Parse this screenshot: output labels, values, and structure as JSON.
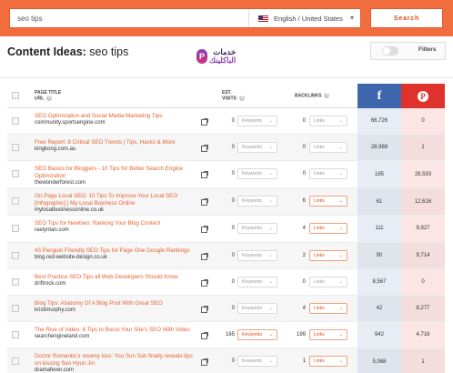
{
  "search": {
    "query": "seo tips",
    "language": "English / United States",
    "button_label": "Search"
  },
  "header": {
    "title_prefix": "Content Ideas:",
    "title_query": "seo tips",
    "filters_label": "Filters",
    "logo_line1": "خدمات",
    "logo_line2": "الباكلينك"
  },
  "columns": {
    "page_title": "PAGE TITLE",
    "url": "URL",
    "est": "EST.",
    "visits": "VISITS",
    "backlinks": "BACKLINKS",
    "facebook": "f",
    "pinterest": "P"
  },
  "dropdown_labels": {
    "keywords": "Keywords",
    "links": "Links"
  },
  "rows": [
    {
      "title": "SEO Optimization and Social Media Marketing Tips",
      "url": "community.sportsengine.com",
      "visits": "0",
      "backlinks": "0",
      "facebook": "66,726",
      "pinterest": "0",
      "kw_active": false,
      "ln_active": false
    },
    {
      "title": "Free Report: 8 Critical SEO Trends | Tips, Hacks & More",
      "url": "kingkong.com.au",
      "visits": "0",
      "backlinks": "0",
      "facebook": "28,988",
      "pinterest": "1",
      "kw_active": false,
      "ln_active": false
    },
    {
      "title": "SEO Basics for Bloggers - 10 Tips for Better Search Engine Optimization",
      "url": "thewonderforest.com",
      "visits": "0",
      "backlinks": "0",
      "facebook": "185",
      "pinterest": "28,593",
      "kw_active": false,
      "ln_active": false
    },
    {
      "title": "On-Page Local SEO: 10 Tips To Improve Your Local SEO [Infographic] | My Local Business Online",
      "url": "mylocalbusinessonline.co.uk",
      "visits": "0",
      "backlinks": "6",
      "facebook": "61",
      "pinterest": "12,616",
      "kw_active": false,
      "ln_active": true
    },
    {
      "title": "SEO Tips for Newbies: Ranking Your Blog Content",
      "url": "raelyntan.com",
      "visits": "0",
      "backlinks": "4",
      "facebook": "111",
      "pinterest": "9,927",
      "kw_active": false,
      "ln_active": true
    },
    {
      "title": "43 Penguin Friendly SEO Tips for Page One Google Rankings",
      "url": "blog.red-website-design.co.uk",
      "visits": "0",
      "backlinks": "2",
      "facebook": "90",
      "pinterest": "9,714",
      "kw_active": false,
      "ln_active": true
    },
    {
      "title": "Best Practice SEO Tips all Web Developers Should Know",
      "url": "driftrock.com",
      "visits": "0",
      "backlinks": "0",
      "facebook": "8,567",
      "pinterest": "0",
      "kw_active": false,
      "ln_active": false
    },
    {
      "title": "Blog Tips: Anatomy Of A Blog Post With Great SEO",
      "url": "kristimurphy.com",
      "visits": "0",
      "backlinks": "4",
      "facebook": "42",
      "pinterest": "8,277",
      "kw_active": false,
      "ln_active": true
    },
    {
      "title": "The Rise of Video: 8 Tips to Boost Your Site's SEO With Video",
      "url": "searchengineland.com",
      "visits": "165",
      "backlinks": "199",
      "facebook": "942",
      "pinterest": "4,716",
      "kw_active": true,
      "ln_active": true
    },
    {
      "title": "Doctor Romantic's steamy kiss: You Sun Suk finally reveals tips on kissing Seo Hyun Jin",
      "url": "dramafever.com",
      "visits": "0",
      "backlinks": "1",
      "facebook": "5,068",
      "pinterest": "1",
      "kw_active": false,
      "ln_active": true
    }
  ],
  "colors": {
    "brand_orange": "#f26d3d",
    "facebook_blue": "#3e66ad",
    "pinterest_red": "#e0322d",
    "link_orange": "#e8622f"
  },
  "icons": {
    "language": "us-flag-icon",
    "external": "external-link-icon",
    "help": "help-icon",
    "dropdown": "chevron-down-icon"
  }
}
